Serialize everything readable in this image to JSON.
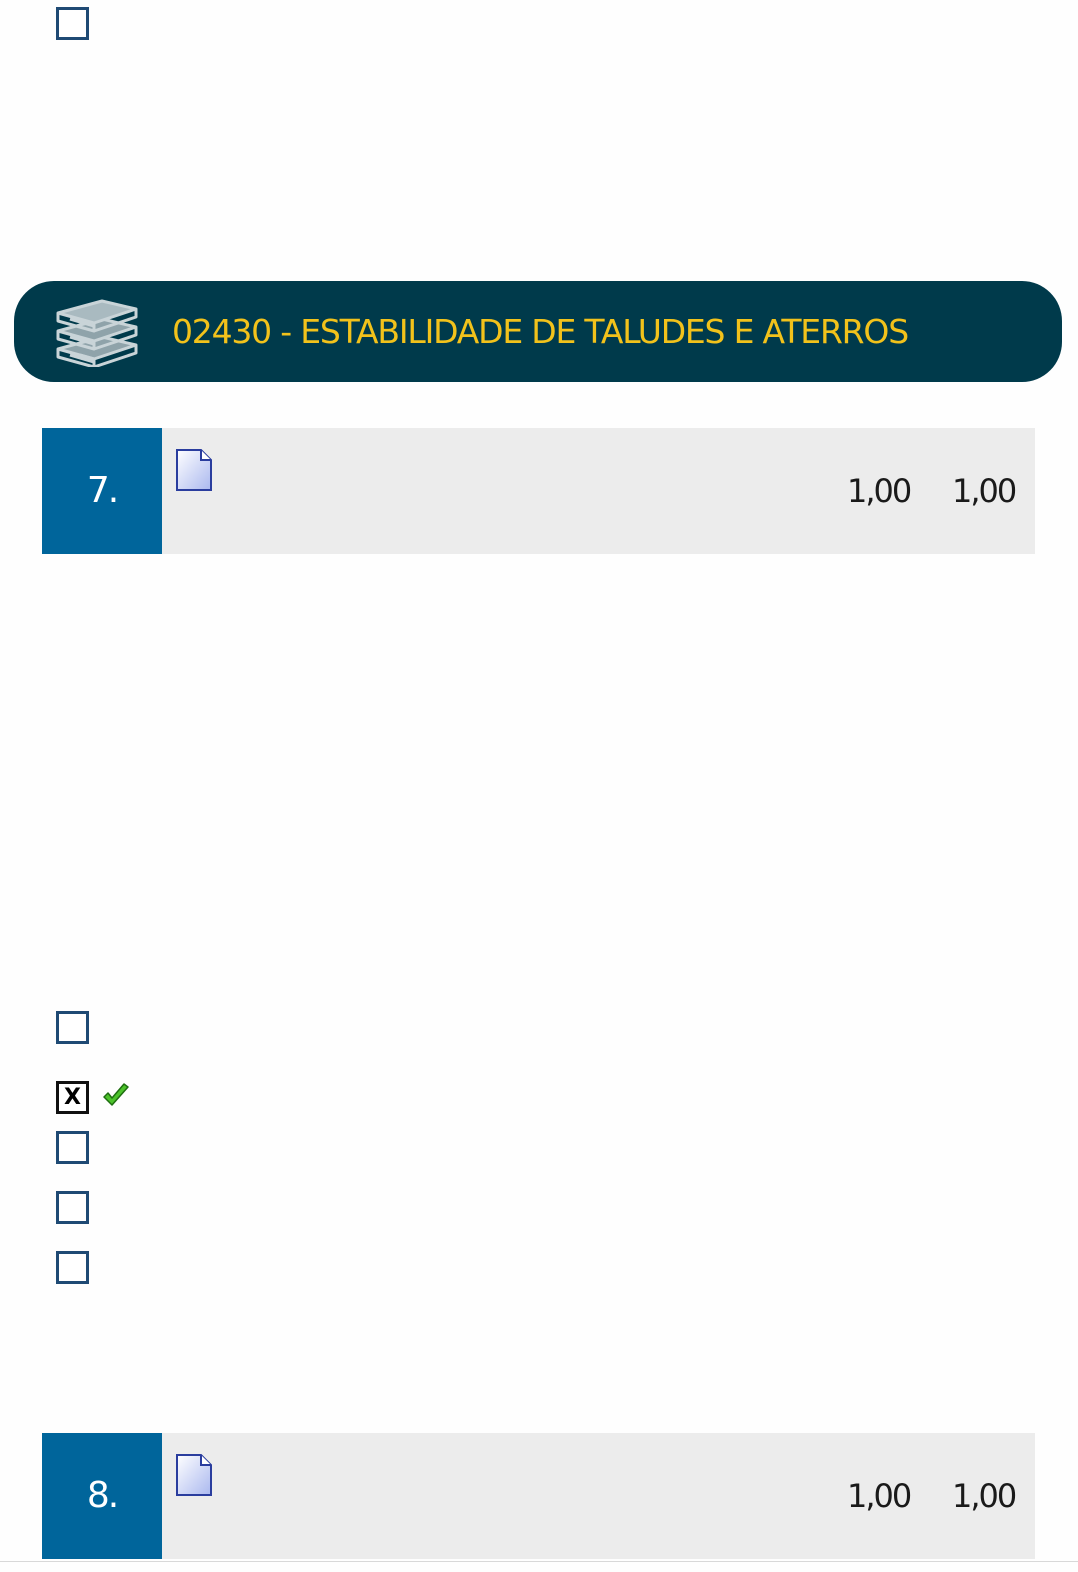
{
  "section": {
    "title": "02430 - ESTABILIDADE DE TALUDES E ATERROS",
    "icon": "books-icon"
  },
  "questions": [
    {
      "number": "7.",
      "score_value": "1,00",
      "score_max": "1,00",
      "icon": "document-icon",
      "options": [
        {
          "checked": false,
          "correct": false
        },
        {
          "checked": true,
          "correct": true,
          "mark": "X"
        },
        {
          "checked": false,
          "correct": false
        },
        {
          "checked": false,
          "correct": false
        },
        {
          "checked": false,
          "correct": false
        }
      ]
    },
    {
      "number": "8.",
      "score_value": "1,00",
      "score_max": "1,00",
      "icon": "document-icon"
    }
  ],
  "colors": {
    "header_bg": "#003a4b",
    "header_text": "#f2c21b",
    "number_bg": "#00659b",
    "row_bg": "#ececec",
    "checkbox_border": "#1f4a74",
    "correct_check": "#3fbf1f"
  }
}
